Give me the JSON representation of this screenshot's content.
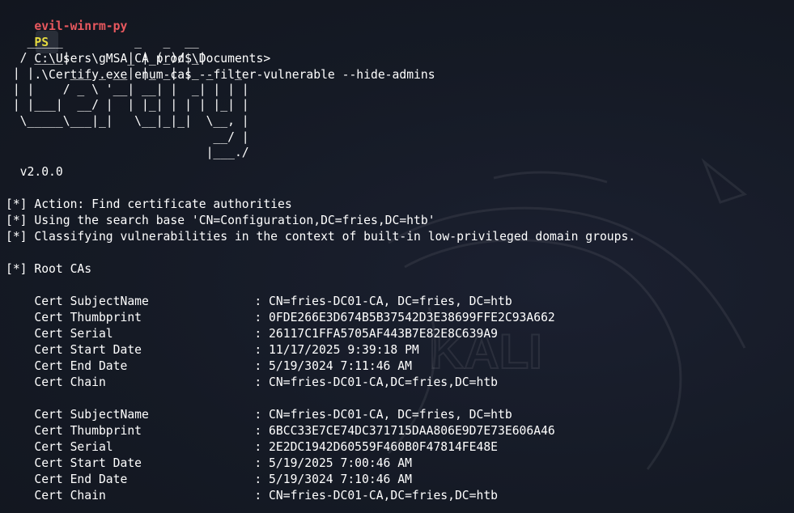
{
  "prompt": {
    "user": "evil-winrm-py",
    "shell": "PS",
    "path": "C:\\Users\\gMSA_CA_prod$\\Documents>",
    "command": ".\\Certify.exe enum-cas --filter-vulnerable --hide-admins"
  },
  "banner": {
    "ascii": "   _____          _   _  __\n  / ____|        | | (_)/ _|\n | |     ___ _ __| |_ _| |_ _   _\n | |    / _ \\ '__| __| |  _| | | |\n | |___|  __/ |  | |_| | | | |_| |\n  \\_____\\___|_|   \\__|_|_|  \\__, |\n                             __/ |\n                            |___./",
    "version": "  v2.0.0"
  },
  "output": {
    "action": "[*] Action: Find certificate authorities",
    "search_base": "[*] Using the search base 'CN=Configuration,DC=fries,DC=htb'",
    "classifying": "[*] Classifying vulnerabilities in the context of built-in low-privileged domain groups.",
    "root_cas": "[*] Root CAs"
  },
  "certs": [
    {
      "subject_label": "Cert SubjectName",
      "subject": ": CN=fries-DC01-CA, DC=fries, DC=htb",
      "thumbprint_label": "Cert Thumbprint",
      "thumbprint": ": 0FDE266E3D674B5B37542D3E38699FFE2C93A662",
      "serial_label": "Cert Serial",
      "serial": ": 26117C1FFA5705AF443B7E82E8C639A9",
      "start_label": "Cert Start Date",
      "start": ": 11/17/2025 9:39:18 PM",
      "end_label": "Cert End Date",
      "end": ": 5/19/3024 7:11:46 AM",
      "chain_label": "Cert Chain",
      "chain": ": CN=fries-DC01-CA,DC=fries,DC=htb"
    },
    {
      "subject_label": "Cert SubjectName",
      "subject": ": CN=fries-DC01-CA, DC=fries, DC=htb",
      "thumbprint_label": "Cert Thumbprint",
      "thumbprint": ": 6BCC33E7CE74DC371715DAA806E9D7E73E606A46",
      "serial_label": "Cert Serial",
      "serial": ": 2E2DC1942D60559F460B0F47814FE48E",
      "start_label": "Cert Start Date",
      "start": ": 5/19/2025 7:00:46 AM",
      "end_label": "Cert End Date",
      "end": ": 5/19/3024 7:10:46 AM",
      "chain_label": "Cert Chain",
      "chain": ": CN=fries-DC01-CA,DC=fries,DC=htb"
    }
  ],
  "watermark": {
    "icon": "kali-dragon-icon",
    "text": "KALI"
  },
  "colors": {
    "background": "#151a25",
    "prompt_user": "#e8585e",
    "prompt_ps": "#e6db3f",
    "text": "#ffffff"
  }
}
